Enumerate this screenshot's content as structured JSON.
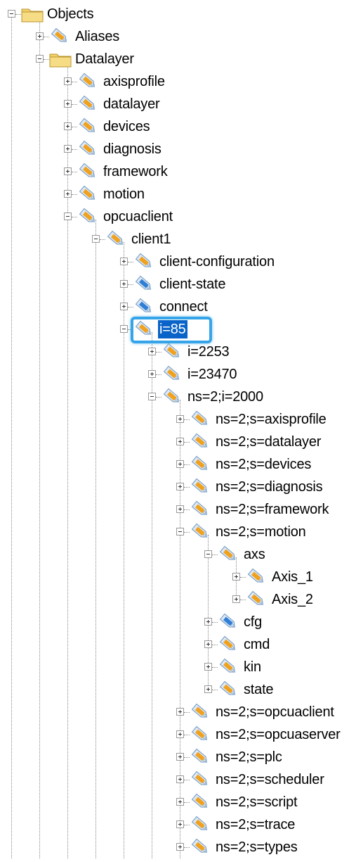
{
  "tree": {
    "nodes": [
      {
        "label": "Objects",
        "icon": "folder-icon",
        "state": "expanded",
        "depth": 0
      },
      {
        "label": "Aliases",
        "icon": "tag-icon",
        "state": "collapsed",
        "depth": 1
      },
      {
        "label": "Datalayer",
        "icon": "folder-icon",
        "state": "expanded",
        "depth": 1
      },
      {
        "label": "axisprofile",
        "icon": "tag-icon",
        "state": "collapsed",
        "depth": 2
      },
      {
        "label": "datalayer",
        "icon": "tag-icon",
        "state": "collapsed",
        "depth": 2
      },
      {
        "label": "devices",
        "icon": "tag-icon",
        "state": "collapsed",
        "depth": 2
      },
      {
        "label": "diagnosis",
        "icon": "tag-icon",
        "state": "collapsed",
        "depth": 2
      },
      {
        "label": "framework",
        "icon": "tag-icon",
        "state": "collapsed",
        "depth": 2
      },
      {
        "label": "motion",
        "icon": "tag-icon",
        "state": "collapsed",
        "depth": 2
      },
      {
        "label": "opcuaclient",
        "icon": "tag-icon",
        "state": "expanded",
        "depth": 2
      },
      {
        "label": "client1",
        "icon": "tag-icon",
        "state": "expanded",
        "depth": 3
      },
      {
        "label": "client-configuration",
        "icon": "tag-icon",
        "state": "collapsed",
        "depth": 4
      },
      {
        "label": "client-state",
        "icon": "variable-tag-icon",
        "state": "collapsed",
        "depth": 4
      },
      {
        "label": "connect",
        "icon": "method-tag-icon",
        "state": "collapsed",
        "depth": 4
      },
      {
        "label": "i=85",
        "icon": "tag-icon",
        "state": "expanded",
        "depth": 4,
        "selected": true
      },
      {
        "label": "i=2253",
        "icon": "tag-icon",
        "state": "collapsed",
        "depth": 5
      },
      {
        "label": "i=23470",
        "icon": "tag-icon",
        "state": "collapsed",
        "depth": 5
      },
      {
        "label": "ns=2;i=2000",
        "icon": "tag-icon",
        "state": "expanded",
        "depth": 5
      },
      {
        "label": "ns=2;s=axisprofile",
        "icon": "tag-icon",
        "state": "collapsed",
        "depth": 6
      },
      {
        "label": "ns=2;s=datalayer",
        "icon": "tag-icon",
        "state": "collapsed",
        "depth": 6
      },
      {
        "label": "ns=2;s=devices",
        "icon": "tag-icon",
        "state": "collapsed",
        "depth": 6
      },
      {
        "label": "ns=2;s=diagnosis",
        "icon": "tag-icon",
        "state": "collapsed",
        "depth": 6
      },
      {
        "label": "ns=2;s=framework",
        "icon": "tag-icon",
        "state": "collapsed",
        "depth": 6
      },
      {
        "label": "ns=2;s=motion",
        "icon": "tag-icon",
        "state": "expanded",
        "depth": 6
      },
      {
        "label": "axs",
        "icon": "tag-icon",
        "state": "expanded",
        "depth": 7
      },
      {
        "label": "Axis_1",
        "icon": "tag-icon",
        "state": "collapsed",
        "depth": 8
      },
      {
        "label": "Axis_2",
        "icon": "tag-icon",
        "state": "collapsed",
        "depth": 8
      },
      {
        "label": "cfg",
        "icon": "variable-tag-icon",
        "state": "collapsed",
        "depth": 7
      },
      {
        "label": "cmd",
        "icon": "tag-icon",
        "state": "collapsed",
        "depth": 7
      },
      {
        "label": "kin",
        "icon": "tag-icon",
        "state": "collapsed",
        "depth": 7
      },
      {
        "label": "state",
        "icon": "tag-icon",
        "state": "collapsed",
        "depth": 7
      },
      {
        "label": "ns=2;s=opcuaclient",
        "icon": "tag-icon",
        "state": "collapsed",
        "depth": 6
      },
      {
        "label": "ns=2;s=opcuaserver",
        "icon": "tag-icon",
        "state": "collapsed",
        "depth": 6
      },
      {
        "label": "ns=2;s=plc",
        "icon": "tag-icon",
        "state": "collapsed",
        "depth": 6
      },
      {
        "label": "ns=2;s=scheduler",
        "icon": "tag-icon",
        "state": "collapsed",
        "depth": 6
      },
      {
        "label": "ns=2;s=script",
        "icon": "tag-icon",
        "state": "collapsed",
        "depth": 6
      },
      {
        "label": "ns=2;s=trace",
        "icon": "tag-icon",
        "state": "collapsed",
        "depth": 6
      },
      {
        "label": "ns=2;s=types",
        "icon": "tag-icon",
        "state": "collapsed",
        "depth": 6
      }
    ]
  },
  "colors": {
    "selection": "#0a63c8",
    "highlight": "#35a4e8",
    "folder": "#f2d06b",
    "tag_orange": "#f0a21f",
    "tag_blue": "#2f7fd6"
  }
}
